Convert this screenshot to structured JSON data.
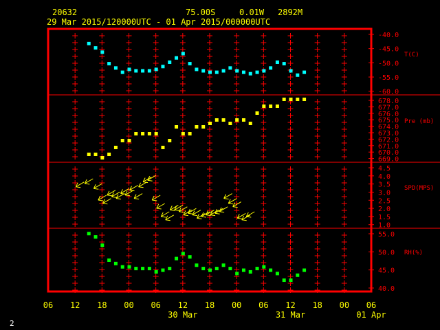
{
  "header": {
    "station": "20632",
    "lat": "75.00S",
    "lon": "0.01W",
    "elev": "2892M",
    "range": "29 Mar 2015/120000UTC - 01 Apr 2015/000000UTC"
  },
  "footer_label": "2",
  "colors": {
    "frame": "#ff0000",
    "text": "#ffff00",
    "temp": "#00ffff",
    "pres": "#ffff00",
    "wind": "#ffff00",
    "rh": "#00ff00"
  },
  "x_axis": {
    "hour_labels": [
      "06",
      "12",
      "18",
      "00",
      "06",
      "12",
      "18",
      "00",
      "06",
      "12",
      "18",
      "00",
      "06"
    ],
    "date_labels": [
      "30 Mar",
      "31 Mar",
      "01 Apr"
    ],
    "range_hours": [
      -6,
      66
    ]
  },
  "chart_data": [
    {
      "type": "scatter",
      "name": "temp",
      "ylabel": "T(C)",
      "yticks": [
        "-40.0",
        "-45.0",
        "-50.0",
        "-55.0",
        "-60.0"
      ],
      "ylim": [
        -60,
        -37
      ],
      "x": [
        3,
        4.5,
        6,
        7.5,
        9,
        10.5,
        12,
        13.5,
        15,
        16.5,
        18,
        19.5,
        21,
        22.5,
        24,
        25.5,
        27,
        28.5,
        30,
        31.5,
        33,
        34.5,
        36,
        37.5,
        39,
        40.5,
        42,
        43.5,
        45,
        46.5,
        48,
        49.5,
        51
      ],
      "values": [
        -42,
        -43.5,
        -45,
        -49,
        -50.5,
        -52,
        -51,
        -51.5,
        -51.5,
        -51.5,
        -51,
        -50,
        -48.5,
        -47,
        -45.5,
        -49,
        -51,
        -51.5,
        -52,
        -52,
        -51.5,
        -50.5,
        -51.5,
        -52,
        -52.5,
        -52,
        -51.5,
        -50.5,
        -48.5,
        -49,
        -51.5,
        -53,
        -52,
        -52,
        -51
      ]
    },
    {
      "type": "scatter",
      "name": "pressure",
      "ylabel": "Pre (mb)",
      "yticks": [
        "678.0",
        "677.0",
        "676.0",
        "675.0",
        "674.0",
        "673.0",
        "672.0",
        "671.0",
        "670.0",
        "669.0"
      ],
      "ylim": [
        668.8,
        678.6
      ],
      "x": [
        3,
        4.5,
        6,
        7.5,
        9,
        10.5,
        12,
        13.5,
        15,
        16.5,
        18,
        19.5,
        21,
        22.5,
        24,
        25.5,
        27,
        28.5,
        30,
        31.5,
        33,
        34.5,
        36,
        37.5,
        39,
        40.5,
        42,
        43.5,
        45,
        46.5,
        48,
        49.5,
        51
      ],
      "values": [
        670,
        670,
        669.5,
        670,
        671,
        672,
        672,
        673,
        673,
        673,
        673,
        671,
        672,
        674,
        673,
        673,
        674,
        674,
        674.5,
        675,
        675,
        674.5,
        675,
        675,
        674.5,
        676,
        677,
        677,
        677,
        678,
        678,
        678,
        678
      ]
    },
    {
      "type": "barbs",
      "name": "wind",
      "ylabel": "SPD(MPS)",
      "yticks": [
        "4.5",
        "4.0",
        "3.5",
        "3.0",
        "2.5",
        "2.0",
        "1.5",
        "1.0"
      ],
      "ylim": [
        0.8,
        4.8
      ],
      "x": [
        2,
        4,
        6,
        7,
        8,
        9,
        10,
        11,
        12,
        13,
        14,
        15,
        16,
        17,
        18,
        19,
        20,
        21,
        22,
        23,
        24,
        25,
        26,
        27,
        28,
        29,
        30,
        31,
        32,
        33,
        34,
        35,
        36,
        37,
        38,
        39,
        40
      ],
      "values": [
        3.6,
        3.8,
        3.5,
        2.8,
        2.6,
        3.1,
        3.0,
        2.9,
        3.2,
        3.1,
        3.4,
        2.9,
        3.6,
        3.9,
        4.0,
        2.8,
        2.3,
        1.8,
        1.6,
        2.2,
        2.2,
        2.1,
        1.9,
        2.0,
        1.9,
        1.7,
        1.8,
        1.9,
        1.9,
        2.0,
        2.1,
        2.9,
        2.6,
        2.4,
        1.7,
        1.6,
        1.8
      ]
    },
    {
      "type": "scatter",
      "name": "rh",
      "ylabel": "RH(%)",
      "yticks": [
        "55.0",
        "50.0",
        "45.0",
        "40.0"
      ],
      "ylim": [
        39.5,
        58.5
      ],
      "x": [
        3,
        4.5,
        6,
        7.5,
        9,
        10.5,
        12,
        13.5,
        15,
        16.5,
        18,
        19.5,
        21,
        22.5,
        24,
        25.5,
        27,
        28.5,
        30,
        31.5,
        33,
        34.5,
        36,
        37.5,
        39,
        40.5,
        42,
        43.5,
        45,
        46.5,
        48,
        49.5,
        51
      ],
      "values": [
        57,
        56,
        53.5,
        49,
        48,
        47,
        47,
        46.5,
        46.5,
        46.5,
        45.5,
        46,
        46.5,
        49.5,
        51,
        50,
        47.5,
        46.5,
        46,
        46.5,
        47.5,
        46.5,
        45,
        46,
        45.5,
        46.5,
        47,
        46,
        45,
        43,
        43,
        44.5,
        46
      ]
    }
  ]
}
